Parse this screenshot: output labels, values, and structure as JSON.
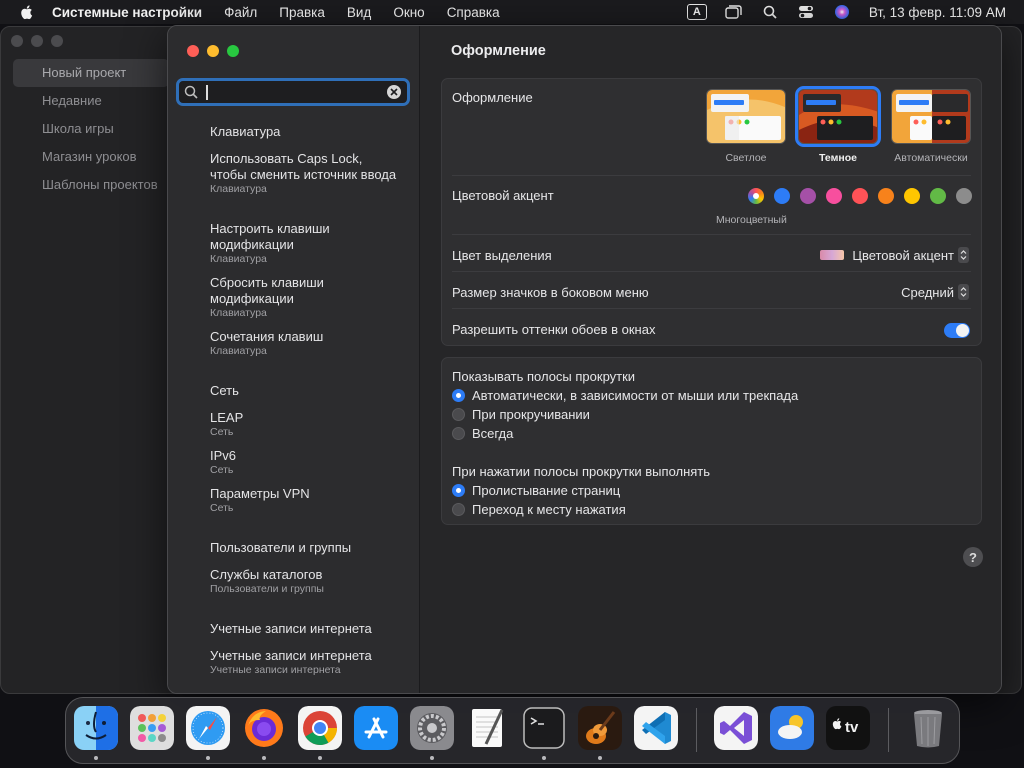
{
  "menubar": {
    "app_name": "Системные настройки",
    "menus": [
      "Файл",
      "Правка",
      "Вид",
      "Окно",
      "Справка"
    ],
    "input_source": "A",
    "clock": "Вт, 13 февр.  11:09 AM"
  },
  "bg_app": {
    "sidebar_items": [
      "Новый проект",
      "Недавние",
      "Школа игры",
      "Магазин уроков",
      "Шаблоны проектов"
    ]
  },
  "search": {
    "value": "",
    "placeholder": ""
  },
  "results": [
    {
      "title": "Клавиатура",
      "sub": ""
    },
    {
      "title": "Использовать Caps Lock, чтобы сменить источник ввода",
      "sub": "Клавиатура"
    },
    {
      "title": "Настроить клавиши модификации",
      "sub": "Клавиатура"
    },
    {
      "title": "Сбросить клавиши модификации",
      "sub": "Клавиатура"
    },
    {
      "title": "Сочетания клавиш",
      "sub": "Клавиатура"
    },
    {
      "title": "Сеть",
      "sub": ""
    },
    {
      "title": "LEAP",
      "sub": "Сеть"
    },
    {
      "title": "IPv6",
      "sub": "Сеть"
    },
    {
      "title": "Параметры VPN",
      "sub": "Сеть"
    },
    {
      "title": "Пользователи и группы",
      "sub": ""
    },
    {
      "title": "Службы каталогов",
      "sub": "Пользователи и группы"
    },
    {
      "title": "Учетные записи интернета",
      "sub": ""
    },
    {
      "title": "Учетные записи интернета",
      "sub": "Учетные записи интернета"
    }
  ],
  "main": {
    "title": "Оформление",
    "appearance": {
      "label": "Оформление",
      "options": [
        "Светлое",
        "Темное",
        "Автоматически"
      ],
      "selected": "Темное"
    },
    "accent": {
      "label": "Цветовой акцент",
      "caption": "Многоцветный",
      "colors": [
        "#2d7cf6",
        "#a550a7",
        "#f74f9e",
        "#ff5257",
        "#f7821b",
        "#ffc600",
        "#62ba46",
        "#8c8c8c"
      ]
    },
    "highlight": {
      "label": "Цвет выделения",
      "value": "Цветовой акцент"
    },
    "sidebar_icon_size": {
      "label": "Размер значков в боковом меню",
      "value": "Средний"
    },
    "wallpaper_tinting": {
      "label": "Разрешить оттенки обоев в окнах",
      "enabled": true
    },
    "scrollbars": {
      "label": "Показывать полосы прокрутки",
      "options": [
        "Автоматически, в зависимости от мыши или трекпада",
        "При прокручивании",
        "Всегда"
      ],
      "selected": 0
    },
    "click_scrollbar": {
      "label": "При нажатии полосы прокрутки выполнять",
      "options": [
        "Пролистывание страниц",
        "Переход к месту нажатия"
      ],
      "selected": 0
    },
    "help": "?"
  },
  "dock": {
    "apps": [
      "finder",
      "launchpad",
      "safari",
      "firefox",
      "chrome",
      "app-store",
      "system-settings",
      "textedit",
      "terminal",
      "garageband",
      "vscode",
      "visual-studio",
      "weather",
      "apple-tv",
      "trash"
    ],
    "tv_label": "tv"
  }
}
